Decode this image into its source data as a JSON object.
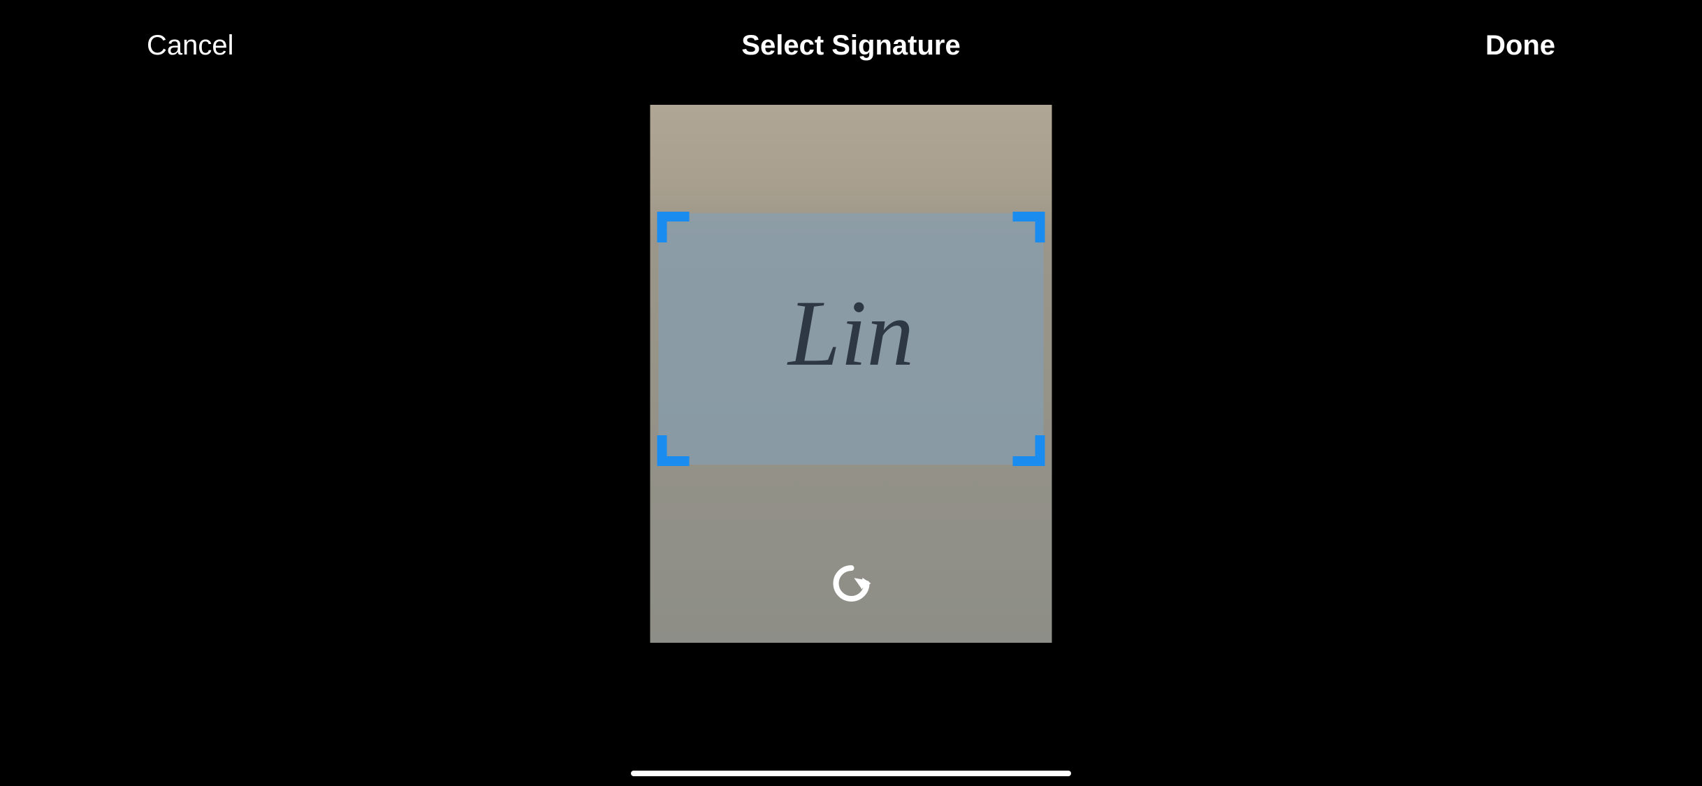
{
  "header": {
    "cancel_label": "Cancel",
    "title": "Select Signature",
    "done_label": "Done"
  },
  "signature": {
    "text": "Lin"
  },
  "controls": {
    "rotate_icon": "rotate-clockwise-icon"
  },
  "colors": {
    "crop_handle": "#1a8cf0",
    "background": "#000000"
  }
}
